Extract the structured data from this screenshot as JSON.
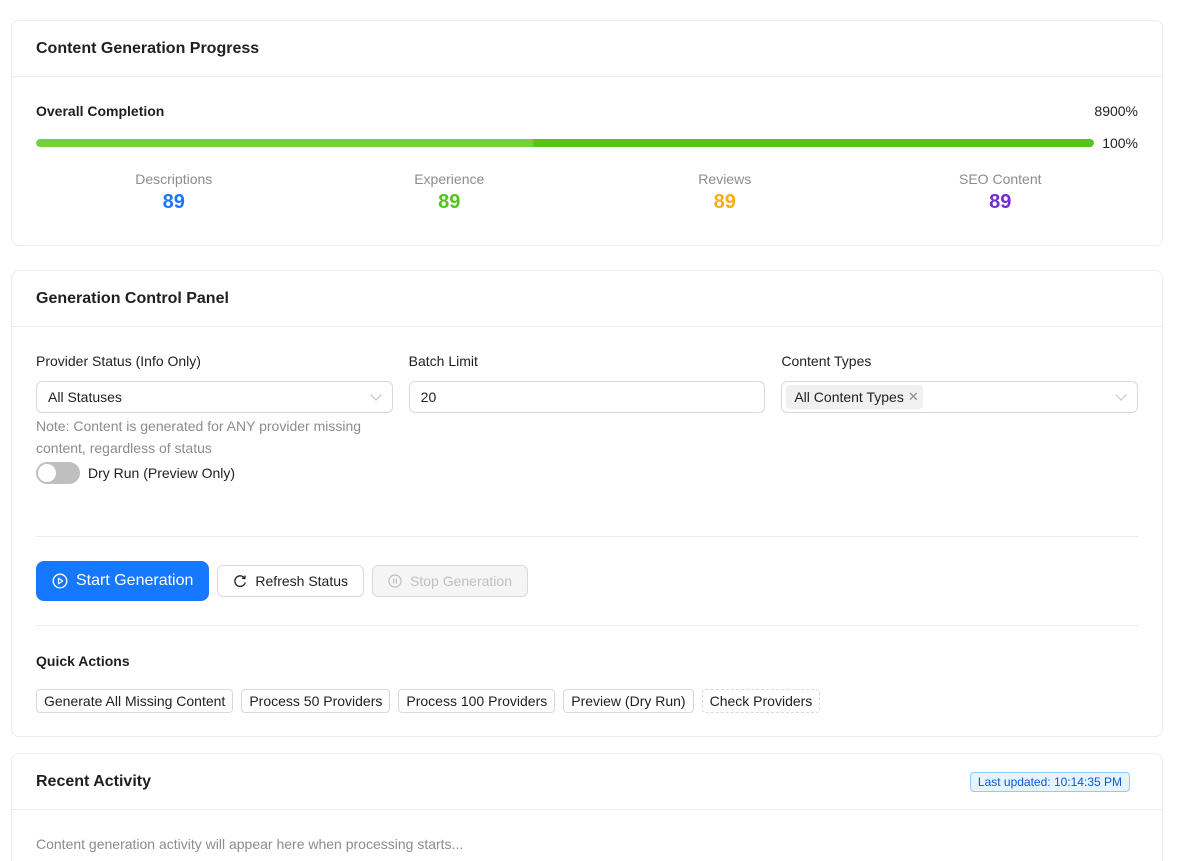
{
  "progress": {
    "title": "Content Generation Progress",
    "overall_label": "Overall Completion",
    "overall_value": "8900%",
    "bar_percent": 100,
    "bar_label": "100%",
    "stats": [
      {
        "label": "Descriptions",
        "value": "89",
        "color": "#1677ff"
      },
      {
        "label": "Experience",
        "value": "89",
        "color": "#52c41a"
      },
      {
        "label": "Reviews",
        "value": "89",
        "color": "#faad14"
      },
      {
        "label": "SEO Content",
        "value": "89",
        "color": "#722ed1"
      }
    ]
  },
  "control": {
    "title": "Generation Control Panel",
    "provider_status": {
      "label": "Provider Status (Info Only)",
      "value": "All Statuses",
      "note": "Note: Content is generated for ANY provider missing content, regardless of status"
    },
    "batch_limit": {
      "label": "Batch Limit",
      "value": "20"
    },
    "content_types": {
      "label": "Content Types",
      "tag": "All Content Types"
    },
    "dry_run": {
      "label": "Dry Run (Preview Only)",
      "enabled": false
    },
    "buttons": {
      "start": "Start Generation",
      "refresh": "Refresh Status",
      "stop": "Stop Generation"
    },
    "quick_actions": {
      "title": "Quick Actions",
      "items": [
        "Generate All Missing Content",
        "Process 50 Providers",
        "Process 100 Providers",
        "Preview (Dry Run)",
        "Check Providers"
      ]
    }
  },
  "activity": {
    "title": "Recent Activity",
    "last_updated": "Last updated: 10:14:35 PM",
    "empty_text": "Content generation activity will appear here when processing starts..."
  }
}
